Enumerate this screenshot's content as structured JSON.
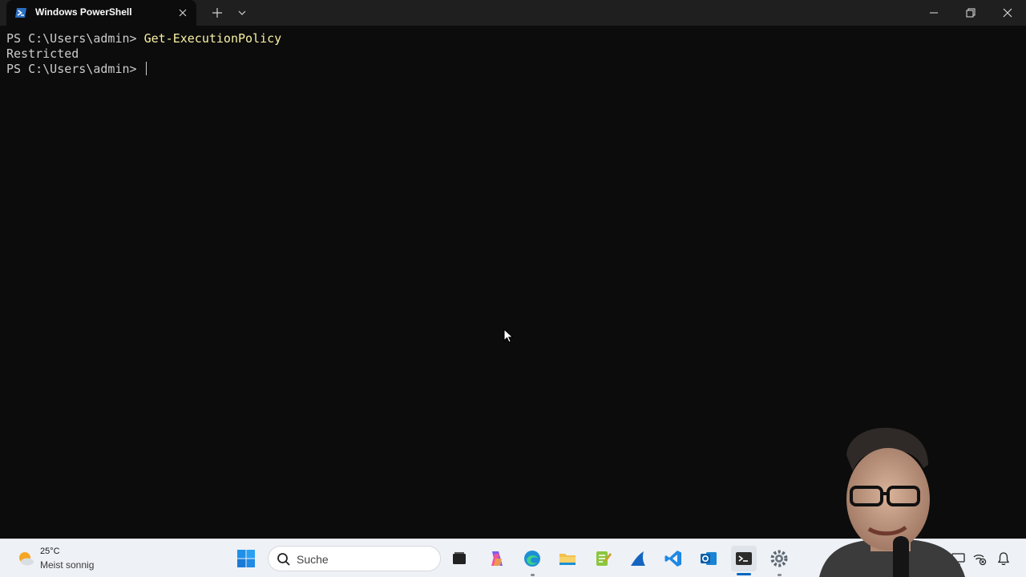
{
  "window": {
    "tab_title": "Windows PowerShell",
    "tab_icon": "powershell-icon",
    "new_tab_icon": "plus-icon",
    "dropdown_icon": "chevron-down-icon",
    "controls": [
      "minimize-icon",
      "restore-icon",
      "close-icon"
    ]
  },
  "terminal": {
    "line1_prompt": "PS C:\\Users\\admin> ",
    "line1_command": "Get-ExecutionPolicy",
    "line2_output": "Restricted",
    "line3_prompt": "PS C:\\Users\\admin> "
  },
  "taskbar": {
    "weather": {
      "temp": "25°C",
      "desc": "Meist sonnig",
      "icon": "sun-cloud-icon"
    },
    "search_placeholder": "Suche",
    "apps": [
      "windows-start-icon",
      "search-icon",
      "task-view-icon",
      "copilot-icon",
      "edge-icon",
      "file-explorer-icon",
      "notepad-plus-plus-icon",
      "wireshark-icon",
      "vscode-icon",
      "outlook-icon",
      "terminal-icon",
      "settings-icon"
    ],
    "tray": [
      "onedrive-icon",
      "display-icon",
      "network-disconnected-icon",
      "notification-bell-icon"
    ]
  },
  "colors": {
    "terminal_bg": "#0c0c0c",
    "terminal_fg": "#cccccc",
    "command_fg": "#f9f1a5",
    "titlebar_bg": "#1f1f1f",
    "taskbar_bg": "#eef1f6",
    "accent": "#0067c0"
  }
}
